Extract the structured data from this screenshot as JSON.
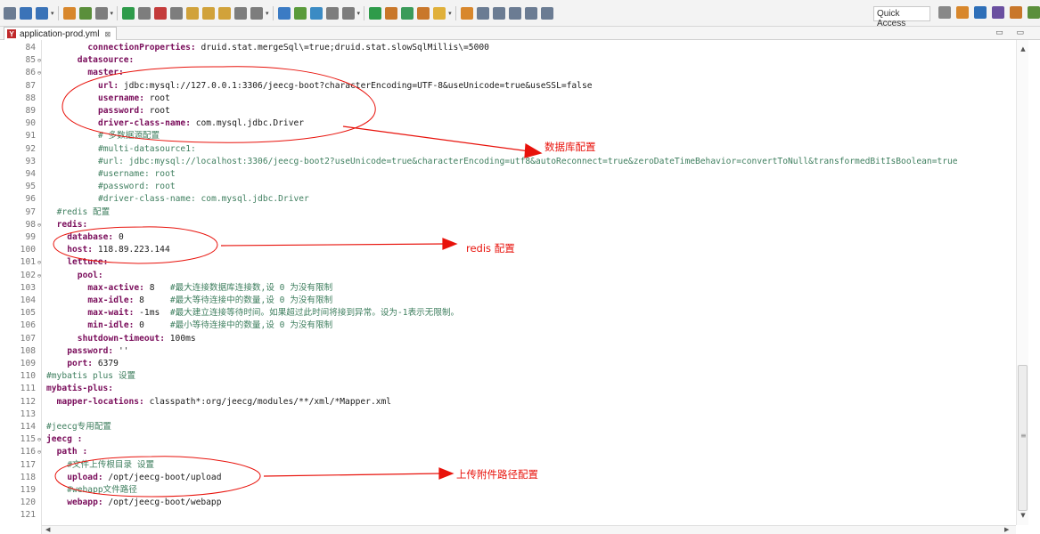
{
  "toolbar": {
    "quick_access_label": "Quick Access",
    "icons": [
      "new-file-icon",
      "save-icon",
      "save-all-icon",
      "debug-icon",
      "skip-breakpoints-icon",
      "toggle-comment-icon",
      "resume-icon",
      "suspend-icon",
      "terminate-icon",
      "disconnect-icon",
      "step-into-icon",
      "step-over-icon",
      "step-return-icon",
      "drop-to-frame-icon",
      "use-step-filters-icon",
      "open-type-icon",
      "open-task-icon",
      "open-perspective-icon",
      "show-whitespace-icon",
      "block-selection-icon",
      "run-icon",
      "debug-run-icon",
      "new-java-class-icon",
      "new-package-icon",
      "open-folder-icon",
      "search-icon",
      "annotation-icon",
      "next-annotation-icon",
      "prev-annotation-icon",
      "back-icon",
      "forward-icon"
    ],
    "perspective_icons": [
      "open-perspective-icon",
      "java-ee-perspective-icon",
      "debug-perspective-icon",
      "java-perspective-icon",
      "git-perspective-icon",
      "team-perspective-icon"
    ]
  },
  "tab": {
    "file_badge": "Y",
    "title": "application-prod.yml",
    "close": "⊠"
  },
  "window_controls": "▭ ▭",
  "editor": {
    "lines": [
      {
        "n": "84",
        "fold": "",
        "parts": [
          {
            "t": "k",
            "s": "connectionProperties:"
          },
          {
            "t": "v",
            "s": " druid.stat.mergeSql\\=true;druid.stat.slowSqlMillis\\=5000"
          }
        ],
        "indent": 8
      },
      {
        "n": "85",
        "fold": "⊖",
        "parts": [
          {
            "t": "k",
            "s": "datasource:"
          }
        ],
        "indent": 6
      },
      {
        "n": "86",
        "fold": "⊖",
        "parts": [
          {
            "t": "k",
            "s": "master:"
          }
        ],
        "indent": 8
      },
      {
        "n": "87",
        "fold": "",
        "parts": [
          {
            "t": "k",
            "s": "url:"
          },
          {
            "t": "v",
            "s": " jdbc:mysql://127.0.0.1:3306/jeecg-boot?characterEncoding=UTF-8&useUnicode=true&useSSL=false"
          }
        ],
        "indent": 10
      },
      {
        "n": "88",
        "fold": "",
        "parts": [
          {
            "t": "k",
            "s": "username:"
          },
          {
            "t": "v",
            "s": " root"
          }
        ],
        "indent": 10
      },
      {
        "n": "89",
        "fold": "",
        "parts": [
          {
            "t": "k",
            "s": "password:"
          },
          {
            "t": "v",
            "s": " root"
          }
        ],
        "indent": 10
      },
      {
        "n": "90",
        "fold": "",
        "parts": [
          {
            "t": "k",
            "s": "driver-class-name:"
          },
          {
            "t": "v",
            "s": " com.mysql.jdbc.Driver"
          }
        ],
        "indent": 10
      },
      {
        "n": "91",
        "fold": "",
        "parts": [
          {
            "t": "c",
            "s": "# 多数据源配置"
          }
        ],
        "indent": 10
      },
      {
        "n": "92",
        "fold": "",
        "parts": [
          {
            "t": "c",
            "s": "#multi-datasource1:"
          }
        ],
        "indent": 10
      },
      {
        "n": "93",
        "fold": "",
        "parts": [
          {
            "t": "c",
            "s": "#url: jdbc:mysql://localhost:3306/jeecg-boot2?useUnicode=true&characterEncoding=utf8&autoReconnect=true&zeroDateTimeBehavior=convertToNull&transformedBitIsBoolean=true"
          }
        ],
        "indent": 10
      },
      {
        "n": "94",
        "fold": "",
        "parts": [
          {
            "t": "c",
            "s": "#username: root"
          }
        ],
        "indent": 10
      },
      {
        "n": "95",
        "fold": "",
        "parts": [
          {
            "t": "c",
            "s": "#password: root"
          }
        ],
        "indent": 10
      },
      {
        "n": "96",
        "fold": "",
        "parts": [
          {
            "t": "c",
            "s": "#driver-class-name: com.mysql.jdbc.Driver"
          }
        ],
        "indent": 10
      },
      {
        "n": "97",
        "fold": "",
        "parts": [
          {
            "t": "c",
            "s": "#redis 配置"
          }
        ],
        "indent": 2
      },
      {
        "n": "98",
        "fold": "⊖",
        "parts": [
          {
            "t": "k",
            "s": "redis:"
          }
        ],
        "indent": 2
      },
      {
        "n": "99",
        "fold": "",
        "parts": [
          {
            "t": "k",
            "s": "database:"
          },
          {
            "t": "v",
            "s": " 0"
          }
        ],
        "indent": 4
      },
      {
        "n": "100",
        "fold": "",
        "parts": [
          {
            "t": "k",
            "s": "host:"
          },
          {
            "t": "v",
            "s": " 118.89.223.144"
          }
        ],
        "indent": 4
      },
      {
        "n": "101",
        "fold": "⊖",
        "parts": [
          {
            "t": "k",
            "s": "lettuce:"
          }
        ],
        "indent": 4
      },
      {
        "n": "102",
        "fold": "⊖",
        "parts": [
          {
            "t": "k",
            "s": "pool:"
          }
        ],
        "indent": 6
      },
      {
        "n": "103",
        "fold": "",
        "parts": [
          {
            "t": "k",
            "s": "max-active:"
          },
          {
            "t": "v",
            "s": " 8   "
          },
          {
            "t": "c",
            "s": "#最大连接数据库连接数,设 0 为没有限制"
          }
        ],
        "indent": 8
      },
      {
        "n": "104",
        "fold": "",
        "parts": [
          {
            "t": "k",
            "s": "max-idle:"
          },
          {
            "t": "v",
            "s": " 8     "
          },
          {
            "t": "c",
            "s": "#最大等待连接中的数量,设 0 为没有限制"
          }
        ],
        "indent": 8
      },
      {
        "n": "105",
        "fold": "",
        "parts": [
          {
            "t": "k",
            "s": "max-wait:"
          },
          {
            "t": "v",
            "s": " -1ms  "
          },
          {
            "t": "c",
            "s": "#最大建立连接等待时间。如果超过此时间将接到异常。设为-1表示无限制。"
          }
        ],
        "indent": 8
      },
      {
        "n": "106",
        "fold": "",
        "parts": [
          {
            "t": "k",
            "s": "min-idle:"
          },
          {
            "t": "v",
            "s": " 0     "
          },
          {
            "t": "c",
            "s": "#最小等待连接中的数量,设 0 为没有限制"
          }
        ],
        "indent": 8
      },
      {
        "n": "107",
        "fold": "",
        "parts": [
          {
            "t": "k",
            "s": "shutdown-timeout:"
          },
          {
            "t": "v",
            "s": " 100ms"
          }
        ],
        "indent": 6
      },
      {
        "n": "108",
        "fold": "",
        "parts": [
          {
            "t": "k",
            "s": "password:"
          },
          {
            "t": "v",
            "s": " ''"
          }
        ],
        "indent": 4
      },
      {
        "n": "109",
        "fold": "",
        "parts": [
          {
            "t": "k",
            "s": "port:"
          },
          {
            "t": "v",
            "s": " 6379"
          }
        ],
        "indent": 4
      },
      {
        "n": "110",
        "fold": "",
        "parts": [
          {
            "t": "c",
            "s": "#mybatis plus 设置"
          }
        ],
        "indent": 0
      },
      {
        "n": "111",
        "fold": "",
        "parts": [
          {
            "t": "k",
            "s": "mybatis-plus:"
          }
        ],
        "indent": 0
      },
      {
        "n": "112",
        "fold": "",
        "parts": [
          {
            "t": "k",
            "s": "mapper-locations:"
          },
          {
            "t": "v",
            "s": " classpath*:org/jeecg/modules/**/xml/*Mapper.xml"
          }
        ],
        "indent": 2
      },
      {
        "n": "113",
        "fold": "",
        "parts": [],
        "indent": 0
      },
      {
        "n": "114",
        "fold": "",
        "parts": [
          {
            "t": "c",
            "s": "#jeecg专用配置"
          }
        ],
        "indent": 0
      },
      {
        "n": "115",
        "fold": "⊖",
        "parts": [
          {
            "t": "k",
            "s": "jeecg :"
          }
        ],
        "indent": 0
      },
      {
        "n": "116",
        "fold": "⊖",
        "parts": [
          {
            "t": "k",
            "s": "path :"
          }
        ],
        "indent": 2
      },
      {
        "n": "117",
        "fold": "",
        "parts": [
          {
            "t": "c",
            "s": "#文件上传根目录 设置"
          }
        ],
        "indent": 4
      },
      {
        "n": "118",
        "fold": "",
        "parts": [
          {
            "t": "k",
            "s": "upload:"
          },
          {
            "t": "v",
            "s": " /opt/jeecg-boot/upload"
          }
        ],
        "indent": 4
      },
      {
        "n": "119",
        "fold": "",
        "parts": [
          {
            "t": "c",
            "s": "#webapp文件路径"
          }
        ],
        "indent": 4
      },
      {
        "n": "120",
        "fold": "",
        "parts": [
          {
            "t": "k",
            "s": "webapp:"
          },
          {
            "t": "v",
            "s": " /opt/jeecg-boot/webapp"
          }
        ],
        "indent": 4
      },
      {
        "n": "121",
        "fold": "",
        "parts": [],
        "indent": 0
      }
    ]
  },
  "annotations": {
    "database_label": "数据库配置",
    "redis_label": "redis 配置",
    "upload_label": "上传附件路径配置",
    "color": "#e8120b"
  },
  "colors": {
    "key": "#7a0d5b",
    "comment": "#3f7f5f",
    "value": "#1a1a1a"
  }
}
